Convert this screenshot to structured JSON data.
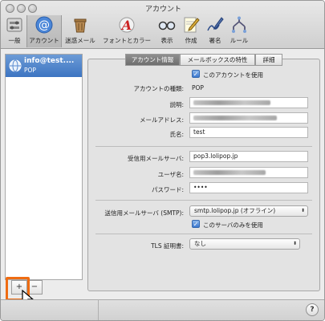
{
  "window": {
    "title": "アカウント"
  },
  "toolbar": {
    "items": [
      {
        "label": "一般",
        "icon": "switch-icon"
      },
      {
        "label": "アカウント",
        "icon": "at-icon"
      },
      {
        "label": "迷惑メール",
        "icon": "trash-icon"
      },
      {
        "label": "フォントとカラー",
        "icon": "font-icon"
      },
      {
        "label": "表示",
        "icon": "glasses-icon"
      },
      {
        "label": "作成",
        "icon": "pencil-icon"
      },
      {
        "label": "署名",
        "icon": "signature-icon"
      },
      {
        "label": "ルール",
        "icon": "rules-icon"
      }
    ],
    "active": "アカウント"
  },
  "sidebar": {
    "accounts": [
      {
        "name": "info@test....",
        "type": "POP"
      }
    ],
    "add_label": "+",
    "remove_label": "−"
  },
  "tabs": [
    {
      "label": "アカウント情報"
    },
    {
      "label": "メールボックスの特性"
    },
    {
      "label": "詳細"
    }
  ],
  "form": {
    "enable_label": "このアカウントを使用",
    "type_label": "アカウントの種類:",
    "type_value": "POP",
    "description_label": "説明:",
    "email_label": "メールアドレス:",
    "fullname_label": "氏名:",
    "fullname_value": "test",
    "incoming_label": "受信用メールサーバ:",
    "incoming_value": "pop3.lolipop.jp",
    "username_label": "ユーザ名:",
    "password_label": "パスワード:",
    "password_value": "••••",
    "smtp_label": "送信用メールサーバ (SMTP):",
    "smtp_value": "smtp.lolipop.jp (オフライン)",
    "smtp_only_label": "このサーバのみを使用",
    "tls_label": "TLS 証明書:",
    "tls_value": "なし"
  },
  "footer": {
    "help_label": "?"
  },
  "colors": {
    "accent": "#3d75c2",
    "highlight": "#ef6c12"
  }
}
